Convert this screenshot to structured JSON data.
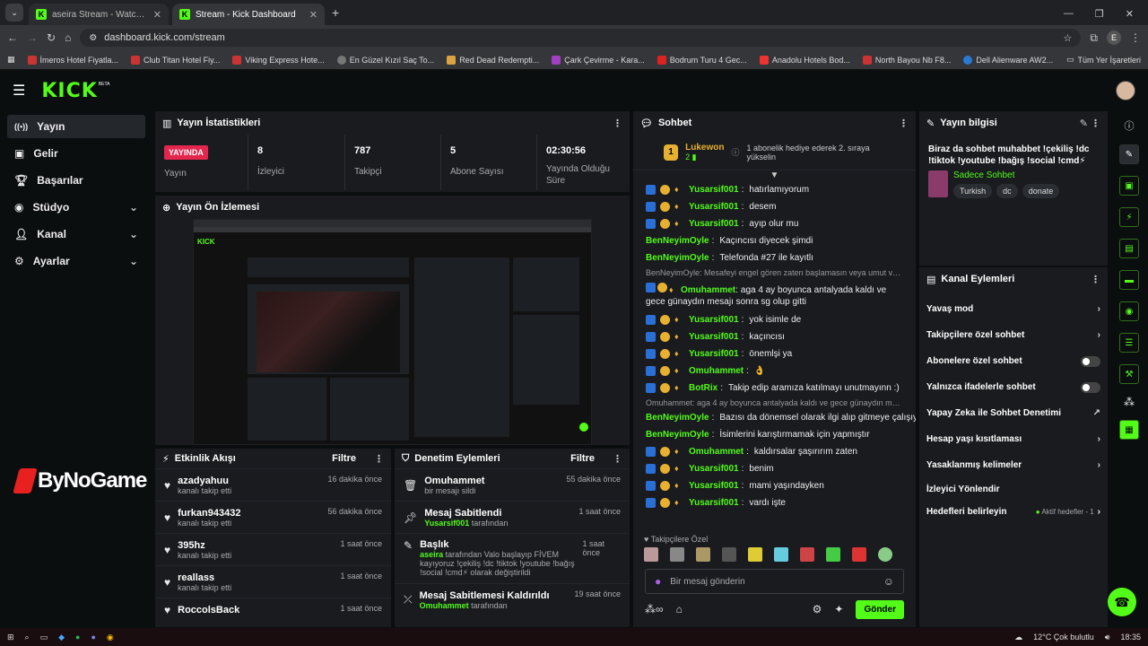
{
  "browser": {
    "tabs": [
      {
        "title": "aseira Stream - Watch Live on K"
      },
      {
        "title": "Stream - Kick Dashboard"
      }
    ],
    "url": "dashboard.kick.com/stream",
    "bookmarks": [
      "İmeros Hotel Fiyatla...",
      "Club Titan Hotel Fiy...",
      "Viking Express Hote...",
      "En Güzel Kızıl Saç To...",
      "Red Dead Redempti...",
      "Çark Çevirme - Kara...",
      "Bodrum Turu 4 Gec...",
      "Anadolu Hotels Bod...",
      "North Bayou Nb F8...",
      "Dell Alienware AW2..."
    ],
    "all_bookmarks": "Tüm Yer İşaretleri",
    "profile_letter": "E"
  },
  "app": {
    "logo": "KICK",
    "beta": "BETA",
    "accent": "#53fc18"
  },
  "sidebar": {
    "items": [
      {
        "label": "Yayın"
      },
      {
        "label": "Gelir"
      },
      {
        "label": "Başarılar"
      },
      {
        "label": "Stüdyo"
      },
      {
        "label": "Kanal"
      },
      {
        "label": "Ayarlar"
      }
    ]
  },
  "stats": {
    "title": "Yayın İstatistikleri",
    "live_badge": "YAYINDA",
    "live_label": "Yayın",
    "cells": [
      {
        "value": "8",
        "label": "İzleyici"
      },
      {
        "value": "787",
        "label": "Takipçi"
      },
      {
        "value": "5",
        "label": "Abone Sayısı"
      },
      {
        "value": "02:30:56",
        "label": "Yayında Olduğu Süre"
      }
    ]
  },
  "preview": {
    "title": "Yayın Ön İzlemesi"
  },
  "watermark": "ByNoGame",
  "activity": {
    "title": "Etkinlik Akışı",
    "filter": "Filtre",
    "items": [
      {
        "name": "azadyahuu",
        "sub": "kanalı takip etti",
        "time": "16 dakika önce"
      },
      {
        "name": "furkan943432",
        "sub": "kanalı takip etti",
        "time": "56 dakika önce"
      },
      {
        "name": "395hz",
        "sub": "kanalı takip etti",
        "time": "1 saat önce"
      },
      {
        "name": "reallass",
        "sub": "kanalı takip etti",
        "time": "1 saat önce"
      },
      {
        "name": "RoccolsBack",
        "sub": "",
        "time": "1 saat önce"
      }
    ]
  },
  "moderation": {
    "title": "Denetim Eylemleri",
    "filter": "Filtre",
    "items": [
      {
        "name": "Omuhammet",
        "sub": "bir mesajı sildi",
        "time": "55 dakika önce"
      },
      {
        "name": "Mesaj Sabitlendi",
        "user": "Yusarsif001",
        "sub": "tarafından",
        "time": "1 saat önce"
      },
      {
        "name": "Başlık",
        "user": "aseira",
        "sub": "tarafından Valo başlayıp FİVEM kayıyoruz !çekiliş !dc !tiktok !youtube !bağış !social !cmd⚡ olarak değiştirildi",
        "time": "1 saat önce"
      },
      {
        "name": "Mesaj Sabitlemesi Kaldırıldı",
        "user": "Omuhammet",
        "sub": "tarafından",
        "time": "19 saat önce"
      }
    ]
  },
  "chat": {
    "title": "Sohbet",
    "pinned_user": "Lukewon",
    "pinned_count": "2",
    "pinned_text": "1 abonelik hediye ederek 2. sıraya yükselin",
    "messages": [
      {
        "user": "Yusarsif001",
        "text": "hatırlamıyorum",
        "badges": true
      },
      {
        "user": "Yusarsif001",
        "text": "desem",
        "badges": true
      },
      {
        "user": "Yusarsif001",
        "text": "ayıp olur mu",
        "badges": true
      },
      {
        "user": "BenNeyimOyle",
        "text": "Kaçıncısı diyecek şimdi",
        "badges": false
      },
      {
        "user": "BenNeyimOyle",
        "text": "Telefonda #27 ile kayıtlı",
        "badges": false
      },
      {
        "reply": "BenNeyimOyle: Mesafeyi engel gören zaten başlamasın veya umut ver...",
        "user": "Omuhammet",
        "text": "aga 4 ay boyunca antalyada kaldı ve gece günaydın mesajı sonra sg olup gitti",
        "badges": true,
        "wrap": true
      },
      {
        "user": "Yusarsif001",
        "text": "yok isimle de",
        "badges": true
      },
      {
        "user": "Yusarsif001",
        "text": "kaçıncısı",
        "badges": true
      },
      {
        "user": "Yusarsif001",
        "text": "önemlşi ya",
        "badges": true
      },
      {
        "user": "Omuhammet",
        "text": "👌",
        "badges": true
      },
      {
        "user": "BotRix",
        "text": "Takip edip aramıza katılmayı unutmayınn :)",
        "badges": true
      },
      {
        "reply": "Omuhammet: aga 4 ay boyunca antalyada kaldı ve gece günaydın mes...",
        "user": "BenNeyimOyle",
        "text": "Bazısı da dönemsel olarak ilgi alıp gitmeye çalışıyor",
        "badges": false
      },
      {
        "user": "BenNeyimOyle",
        "text": "İsimlerini karıştırmamak için yapmıştır",
        "badges": false
      },
      {
        "user": "Omuhammet",
        "text": "kaldırsalar şaşırırım zaten",
        "badges": true
      },
      {
        "user": "Yusarsif001",
        "text": "benim",
        "badges": true
      },
      {
        "user": "Yusarsif001",
        "text": "mami yaşındayken",
        "badges": true
      },
      {
        "user": "Yusarsif001",
        "text": "vardı işte",
        "badges": true
      }
    ],
    "follower_label": "Takipçilere Özel",
    "input_placeholder": "Bir mesaj gönderin",
    "send": "Gönder"
  },
  "info": {
    "title": "Yayın bilgisi",
    "stream_title": "Biraz da sohbet muhabbet !çekiliş !dc !tiktok !youtube !bağış !social !cmd⚡",
    "category": "Sadece Sohbet",
    "tags": [
      "Turkish",
      "dc",
      "donate"
    ]
  },
  "channel_actions": {
    "title": "Kanal Eylemleri",
    "items": [
      {
        "label": "Yavaş mod",
        "kind": "arrow"
      },
      {
        "label": "Takipçilere özel sohbet",
        "kind": "arrow"
      },
      {
        "label": "Abonelere özel sohbet",
        "kind": "toggle"
      },
      {
        "label": "Yalnızca ifadelerle sohbet",
        "kind": "toggle"
      },
      {
        "label": "Yapay Zeka ile Sohbet Denetimi",
        "kind": "external"
      },
      {
        "label": "Hesap yaşı kısıtlaması",
        "kind": "arrow"
      },
      {
        "label": "Yasaklanmış kelimeler",
        "kind": "arrow"
      },
      {
        "label": "İzleyici Yönlendir",
        "kind": "none"
      },
      {
        "label": "Hedefleri belirleyin",
        "kind": "goal",
        "extra": "Aktif hedefler - 1"
      }
    ]
  },
  "taskbar": {
    "weather": "12°C Çok bulutlu",
    "time": "18:35"
  }
}
